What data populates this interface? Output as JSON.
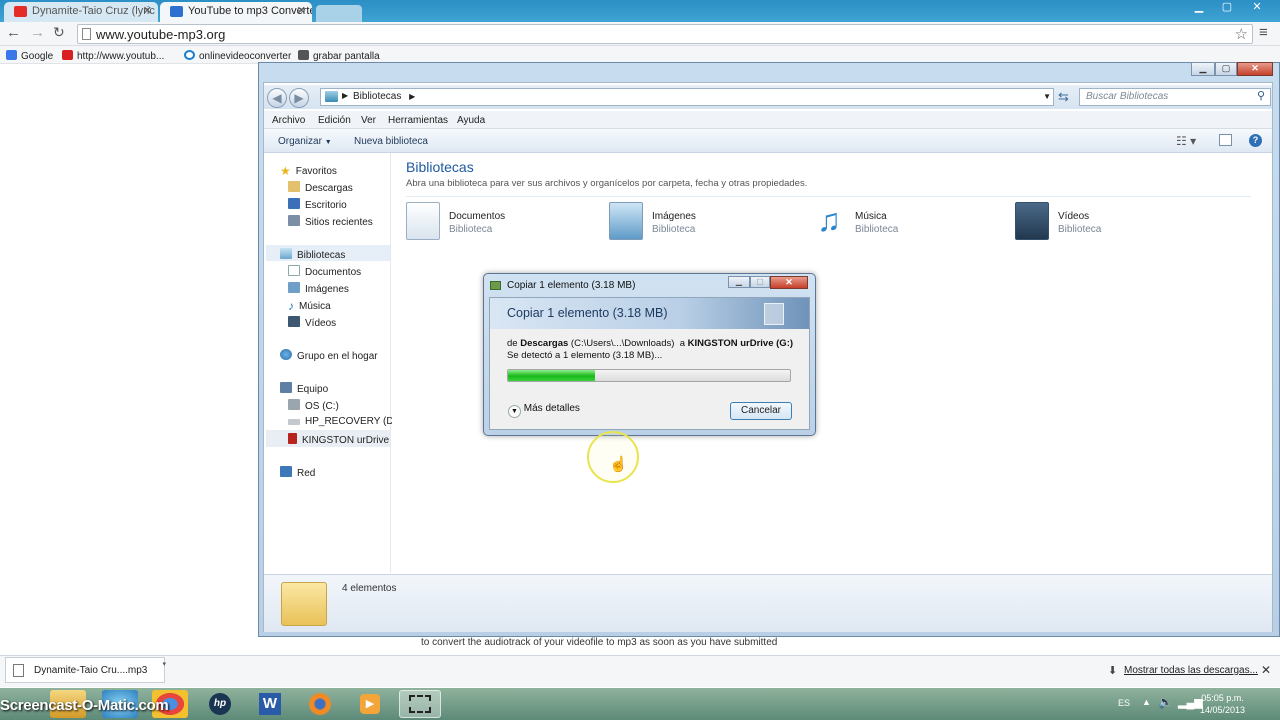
{
  "browser": {
    "tabs": [
      {
        "title": "Dynamite-Taio Cruz (lyric",
        "favicon_color": "#e52d27"
      },
      {
        "title": "YouTube to mp3 Converte",
        "favicon_color": "#2f6fd1"
      }
    ],
    "url": "www.youtube-mp3.org",
    "bookmarks": [
      {
        "label": "Google",
        "icon": "google-icon"
      },
      {
        "label": "http://www.youtub...",
        "icon": "youtube-icon"
      },
      {
        "label": "onlinevideoconverter",
        "icon": "converter-icon"
      },
      {
        "label": "grabar pantalla",
        "icon": "screen-record-icon"
      }
    ],
    "page_text": "to convert the audiotrack of your videofile to mp3 as soon as you have submitted"
  },
  "explorer": {
    "breadcrumb": "Bibliotecas",
    "search_placeholder": "Buscar Bibliotecas",
    "menu": [
      "Archivo",
      "Edición",
      "Ver",
      "Herramientas",
      "Ayuda"
    ],
    "commands": {
      "organize": "Organizar",
      "new_library": "Nueva biblioteca"
    },
    "nav": {
      "favorites": "Favoritos",
      "favorites_items": [
        "Descargas",
        "Escritorio",
        "Sitios recientes"
      ],
      "libraries": "Bibliotecas",
      "libraries_items": [
        "Documentos",
        "Imágenes",
        "Música",
        "Vídeos"
      ],
      "homegroup": "Grupo en el hogar",
      "computer": "Equipo",
      "computer_items": [
        "OS (C:)",
        "HP_RECOVERY (D:)",
        "KINGSTON urDrive ("
      ],
      "network": "Red"
    },
    "content": {
      "title": "Bibliotecas",
      "subtitle": "Abra una biblioteca para ver sus archivos y organícelos por carpeta, fecha y otras propiedades.",
      "libraries": [
        {
          "name": "Documentos",
          "type": "Biblioteca"
        },
        {
          "name": "Imágenes",
          "type": "Biblioteca"
        },
        {
          "name": "Música",
          "type": "Biblioteca"
        },
        {
          "name": "Vídeos",
          "type": "Biblioteca"
        }
      ]
    },
    "status": "4 elementos"
  },
  "copy_dialog": {
    "window_title": "Copiar 1 elemento (3.18 MB)",
    "heading": "Copiar 1 elemento (3.18 MB)",
    "from_word": "de",
    "source_name": "Descargas",
    "source_path": "(C:\\Users\\...\\Downloads)",
    "to_word": "a",
    "dest_name": "KINGSTON urDrive (G:)",
    "detected": "Se detectó a 1 elemento (3.18 MB)...",
    "progress_percent": 31,
    "more_details": "Más detalles",
    "cancel": "Cancelar"
  },
  "downloads": {
    "file": "Dynamite-Taio Cru....mp3",
    "show_all": "Mostrar todas las descargas..."
  },
  "taskbar": {
    "watermark": "Screencast-O-Matic.com",
    "language": "ES",
    "time": "05:05 p.m.",
    "date": "14/05/2013"
  }
}
